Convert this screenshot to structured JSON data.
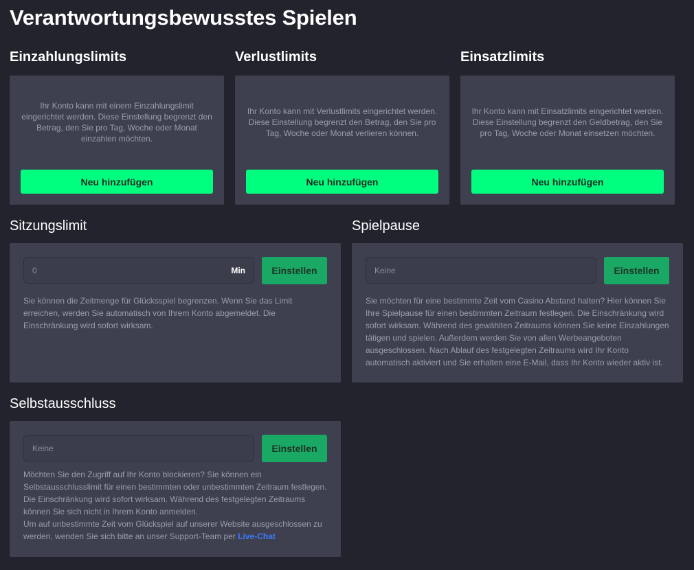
{
  "page": {
    "title": "Verantwortungsbewusstes Spielen"
  },
  "deposit_limits": {
    "title": "Einzahlungslimits",
    "description": "Ihr Konto kann mit einem Einzahlungslimit eingerichtet werden. Diese Einstellung begrenzt den Betrag, den Sie pro Tag, Woche oder Monat einzahlen möchten.",
    "button": "Neu hinzufügen"
  },
  "loss_limits": {
    "title": "Verlustlimits",
    "description": "Ihr Konto kann mit Verlustlimits eingerichtet werden. Diese Einstellung begrenzt den Betrag, den Sie pro Tag, Woche oder Monat verlieren können.",
    "button": "Neu hinzufügen"
  },
  "wager_limits": {
    "title": "Einsatzlimits",
    "description": "Ihr Konto kann mit Einsatzlimits eingerichtet werden. Diese Einstellung begrenzt den Geldbetrag, den Sie pro Tag, Woche oder Monat einsetzen möchten.",
    "button": "Neu hinzufügen"
  },
  "session_limit": {
    "title": "Sitzungslimit",
    "input_placeholder": "0",
    "input_value": "",
    "unit": "Min",
    "button": "Einstellen",
    "description": "Sie können die Zeitmenge für Glücksspiel begrenzen. Wenn Sie das Limit erreichen, werden Sie automatisch von Ihrem Konto abgemeldet. Die Einschränkung wird sofort wirksam."
  },
  "game_break": {
    "title": "Spielpause",
    "input_placeholder": "Keine",
    "button": "Einstellen",
    "description": "Sie möchten für eine bestimmte Zeit vom Casino Abstand halten? Hier können Sie Ihre Spielpause für einen bestimmten Zeitraum festlegen. Die Einschränkung wird sofort wirksam. Während des gewählten Zeitraums können Sie keine Einzahlungen tätigen und spielen. Außerdem werden Sie von allen Werbeangeboten ausgeschlossen. Nach Ablauf des festgelegten Zeitraums wird Ihr Konto automatisch aktiviert und Sie erhalten eine E-Mail, dass Ihr Konto wieder aktiv ist."
  },
  "self_exclusion": {
    "title": "Selbstausschluss",
    "input_placeholder": "Keine",
    "button": "Einstellen",
    "description": "Möchten Sie den Zugriff auf Ihr Konto blockieren? Sie können ein Selbstausschlusslimit für einen bestimmten oder unbestimmten Zeitraum festlegen. Die Einschränkung wird sofort wirksam. Während des festgelegten Zeitraums können Sie sich nicht in Ihrem Konto anmelden.",
    "support_text": "Um auf unbestimmte Zeit vom Glückspiel auf unserer Website ausgeschlossen zu werden, wenden Sie sich bitte an unser Support-Team per",
    "live_chat_link": "Live-Chat"
  },
  "colors": {
    "background": "#22232d",
    "card": "#3e404f",
    "primary_button": "#00ff7f",
    "set_button": "#1aa965",
    "link": "#3d7bff"
  }
}
